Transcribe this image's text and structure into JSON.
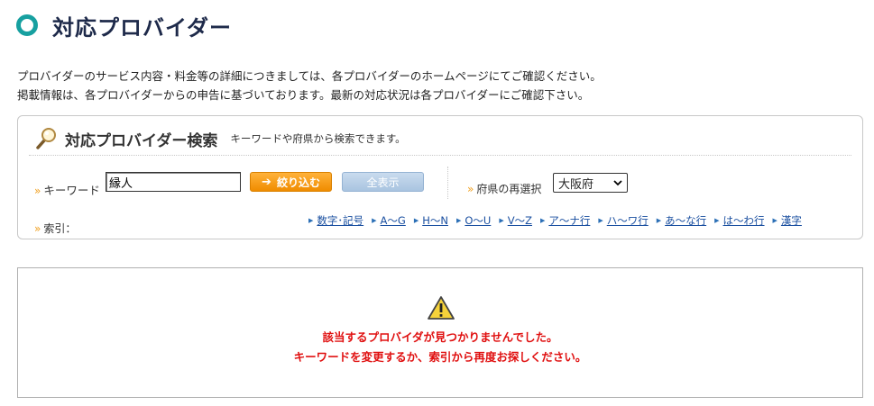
{
  "page": {
    "title": "対応プロバイダー"
  },
  "intro": {
    "line1": "プロバイダーのサービス内容・料金等の詳細につきましては、各プロバイダーのホームページにてご確認ください。",
    "line2": "掲載情報は、各プロバイダーからの申告に基づいております。最新の対応状況は各プロバイダーにご確認下さい。"
  },
  "search": {
    "title": "対応プロバイダー検索",
    "subtitle": "キーワードや府県から検索できます。",
    "keyword_label": "キーワード",
    "keyword_value": "縁人",
    "filter_button": "絞り込む",
    "show_all_button": "全表示",
    "prefecture_label": "府県の再選択",
    "prefecture_selected": "大阪府",
    "index_label": "索引：",
    "index_links": [
      "数字･記号",
      "A～G",
      "H～N",
      "O～U",
      "V～Z",
      "ア～ナ行",
      "ハ～ワ行",
      "あ～な行",
      "は～わ行",
      "漢字"
    ]
  },
  "result": {
    "message1": "該当するプロバイダが見つかりませんでした。",
    "message2": "キーワードを変更するか、索引から再度お探しください。"
  },
  "colors": {
    "accent_teal": "#17a0a0",
    "orange": "#f08c00",
    "error_red": "#e01010",
    "link_blue": "#1a4fa0"
  }
}
